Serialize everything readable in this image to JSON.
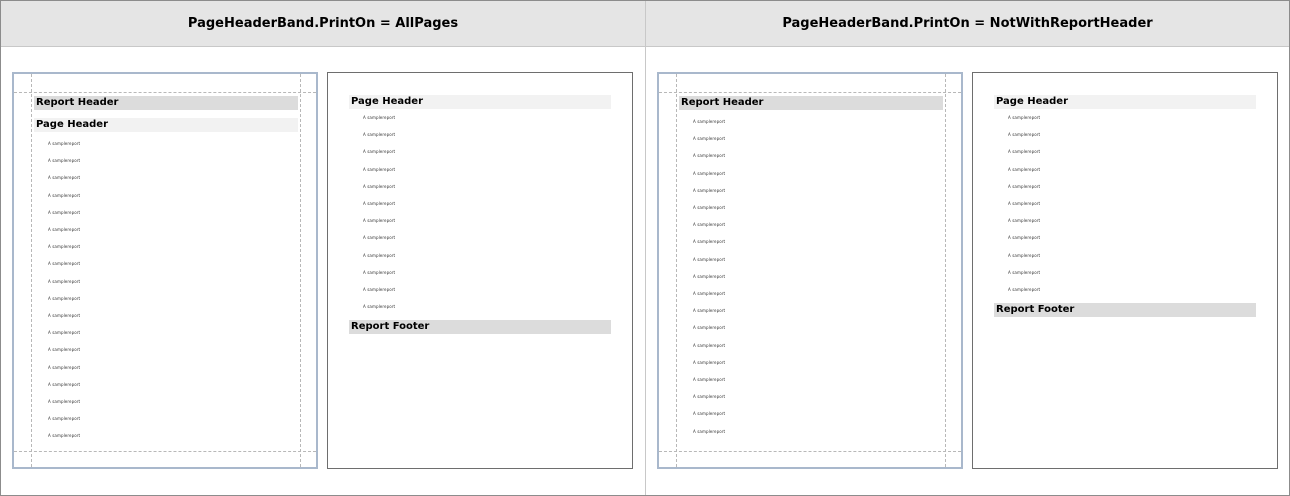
{
  "columns": [
    {
      "title": "PageHeaderBand.PrintOn = AllPages",
      "pages": [
        {
          "bands": [
            {
              "kind": "rh",
              "label": "Report Header"
            },
            {
              "kind": "ph",
              "label": "Page Header"
            }
          ],
          "sample_text": "A samplereport",
          "detail_rows": 18
        },
        {
          "bands": [
            {
              "kind": "ph",
              "label": "Page Header"
            }
          ],
          "sample_text": "A samplereport",
          "detail_rows": 12,
          "footer": "Report Footer"
        }
      ]
    },
    {
      "title": "PageHeaderBand.PrintOn = NotWithReportHeader",
      "pages": [
        {
          "bands": [
            {
              "kind": "rh",
              "label": "Report Header"
            }
          ],
          "sample_text": "A samplereport",
          "detail_rows": 19
        },
        {
          "bands": [
            {
              "kind": "ph",
              "label": "Page Header"
            }
          ],
          "sample_text": "A samplereport",
          "detail_rows": 11,
          "footer": "Report Footer"
        }
      ]
    }
  ]
}
